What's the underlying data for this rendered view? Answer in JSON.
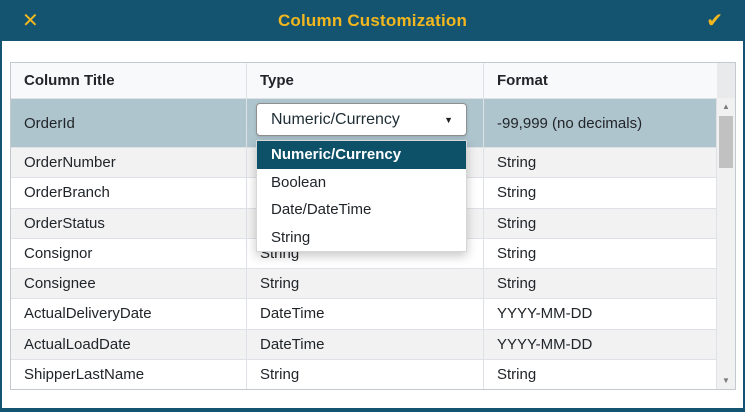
{
  "dialog": {
    "title": "Column Customization",
    "close_glyph": "✕",
    "confirm_glyph": "✔"
  },
  "colors": {
    "titlebar_bg": "#155470",
    "accent_gold": "#F2B71E",
    "selected_row_bg": "#AFC5CE",
    "option_highlight_bg": "#0D5168",
    "alt_row_bg": "#F2F2F2"
  },
  "table": {
    "columns": [
      "Column Title",
      "Type",
      "Format"
    ],
    "rows": [
      {
        "title": "OrderId",
        "type": "",
        "format": "-99,999 (no decimals)",
        "selected": true
      },
      {
        "title": "OrderNumber",
        "type": "",
        "format": "String",
        "selected": false
      },
      {
        "title": "OrderBranch",
        "type": "",
        "format": "String",
        "selected": false
      },
      {
        "title": "OrderStatus",
        "type": "",
        "format": "String",
        "selected": false
      },
      {
        "title": "Consignor",
        "type": "String",
        "format": "String",
        "selected": false
      },
      {
        "title": "Consignee",
        "type": "String",
        "format": "String",
        "selected": false
      },
      {
        "title": "ActualDeliveryDate",
        "type": "DateTime",
        "format": "YYYY-MM-DD",
        "selected": false
      },
      {
        "title": "ActualLoadDate",
        "type": "DateTime",
        "format": "YYYY-MM-DD",
        "selected": false
      },
      {
        "title": "ShipperLastName",
        "type": "String",
        "format": "String",
        "selected": false
      }
    ]
  },
  "dropdown": {
    "value": "Numeric/Currency",
    "caret_glyph": "▼",
    "options": [
      "Numeric/Currency",
      "Boolean",
      "Date/DateTime",
      "String"
    ],
    "highlighted_index": 0
  },
  "scrollbar": {
    "up_glyph": "▲",
    "down_glyph": "▼"
  }
}
